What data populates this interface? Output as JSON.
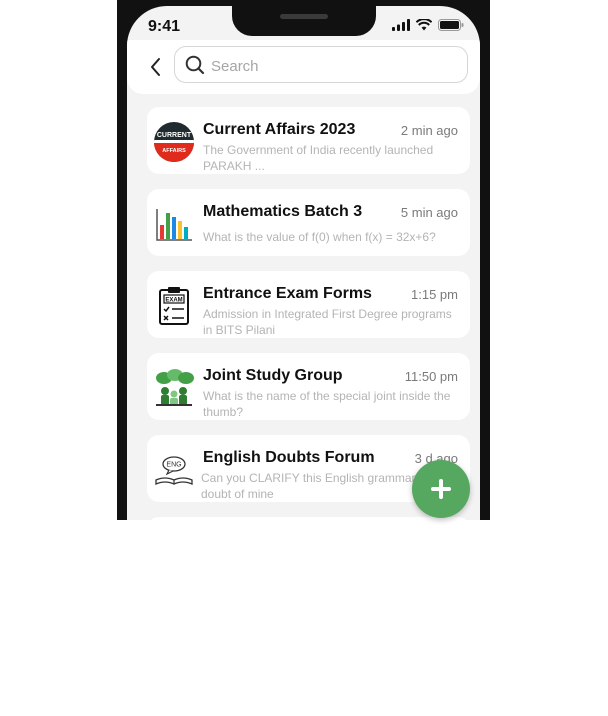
{
  "status_bar": {
    "time": "9:41"
  },
  "search": {
    "placeholder": "Search",
    "value": ""
  },
  "chats": [
    {
      "title": "Current Affairs 2023",
      "time": "2 min ago",
      "preview": "The Government of India recently launched PARAKH ...",
      "icon": "current-affairs-logo",
      "logo_text_1": "CURRENT",
      "logo_text_2": "AFFAIRS"
    },
    {
      "title": "Mathematics Batch 3",
      "time": "5 min ago",
      "preview": "What is the value of f(0) when f(x) = 32x+6?",
      "icon": "bar-chart-icon"
    },
    {
      "title": "Entrance Exam Forms",
      "time": "1:15 pm",
      "preview": "Admission in Integrated First Degree programs in BITS Pilani",
      "icon": "exam-clipboard-icon",
      "logo_text": "EXAM"
    },
    {
      "title": "Joint Study Group",
      "time": "11:50 pm",
      "preview": "What is the name of the special joint inside the thumb?",
      "icon": "study-group-icon"
    },
    {
      "title": "English Doubts Forum",
      "time": "3 d ago",
      "preview": "Can you CLARIFY this English grammar doubt of mine",
      "icon": "eng-book-icon",
      "logo_text": "ENG"
    }
  ],
  "fab": {
    "icon": "plus-icon"
  },
  "colors": {
    "accent": "#56a760",
    "background": "#f3f3f4",
    "card": "#ffffff"
  }
}
